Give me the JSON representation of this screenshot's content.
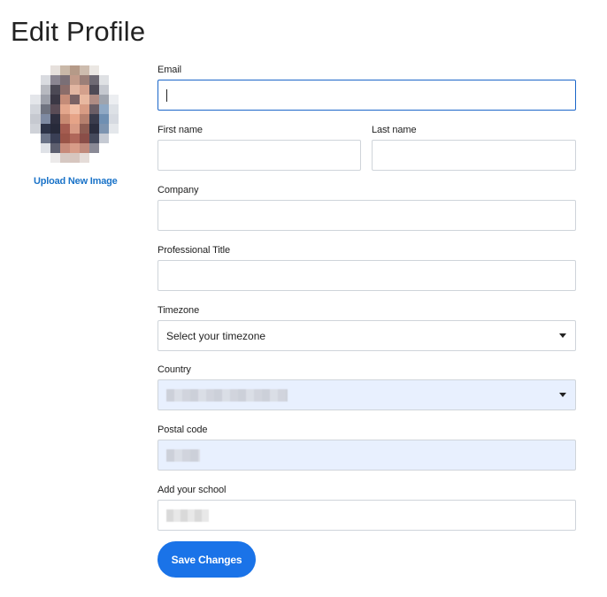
{
  "page": {
    "title": "Edit Profile"
  },
  "avatar": {
    "upload_label": "Upload New Image"
  },
  "form": {
    "email": {
      "label": "Email",
      "value": ""
    },
    "first_name": {
      "label": "First name",
      "value": ""
    },
    "last_name": {
      "label": "Last name",
      "value": ""
    },
    "company": {
      "label": "Company",
      "value": ""
    },
    "professional_title": {
      "label": "Professional Title",
      "value": ""
    },
    "timezone": {
      "label": "Timezone",
      "selected": "Select your timezone"
    },
    "country": {
      "label": "Country",
      "selected": ""
    },
    "postal_code": {
      "label": "Postal code",
      "value": ""
    },
    "school": {
      "label": "Add your school",
      "value": ""
    },
    "save_label": "Save Changes"
  },
  "colors": {
    "accent": "#1a73e8",
    "link": "#1a73c8",
    "focus_border": "#1b66c9",
    "autofill_bg": "#e8f0fe"
  },
  "icons": {
    "select_arrow": "caret-down-icon"
  }
}
